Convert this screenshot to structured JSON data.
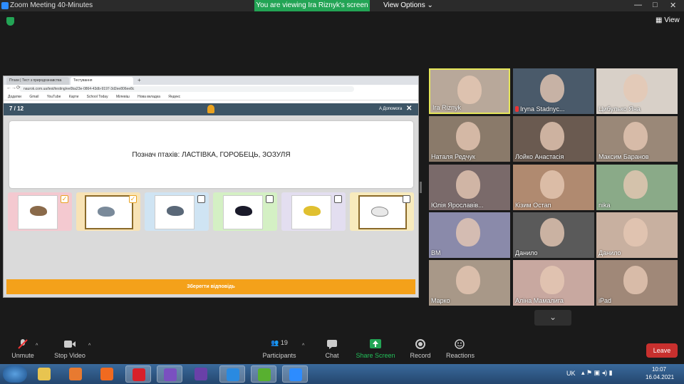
{
  "window": {
    "title": "Zoom Meeting 40-Minutes",
    "minimize": "—",
    "maximize": "□",
    "close": "✕"
  },
  "banner": {
    "text": "You are viewing Ira Riznyk's screen",
    "view_options": "View Options ⌄"
  },
  "view_button": {
    "label": "View"
  },
  "browser": {
    "tabs": [
      "Птахи | Тест з природознавства",
      "Тестування"
    ],
    "address": "naurok.com.ua/test/testing/ee0ba23e-0864-43db-9197-3d2ee806ee8c",
    "bookmarks": [
      "Додатки",
      "Gmail",
      "YouTube",
      "Карти",
      "School Today",
      "Мiлевiш",
      "Нова вкладка",
      "Яндекс"
    ]
  },
  "quiz": {
    "counter": "7 / 12",
    "help_link": "A Допомога",
    "close": "✕",
    "question": "Познач птахів: ЛАСТІВКА, ГОРОБЕЦЬ, ЗОЗУЛЯ",
    "save_button": "Зберегти відповідь",
    "options": [
      {
        "bird": "sparrow",
        "checked": true,
        "bg": "#f4c9d0"
      },
      {
        "bird": "cuckoo",
        "checked": true,
        "bg": "#f8e3b5"
      },
      {
        "bird": "pigeon",
        "checked": false,
        "bg": "#cfe4f3"
      },
      {
        "bird": "swallow",
        "checked": false,
        "bg": "#d4f0c4"
      },
      {
        "bird": "tit",
        "checked": false,
        "bg": "#e3def0"
      },
      {
        "bird": "stork",
        "checked": false,
        "bg": "#f8ebbd"
      }
    ]
  },
  "participants": [
    {
      "name": "Ira Riznyk",
      "muted": false,
      "active": true,
      "bg": "#b8a89a"
    },
    {
      "name": "Iryna Stadnyc...",
      "muted": true,
      "active": false,
      "bg": "#4a5a6a"
    },
    {
      "name": "Цибулько Яна",
      "muted": false,
      "active": false,
      "bg": "#d8d0c8"
    },
    {
      "name": "Наталя Редчук",
      "muted": false,
      "active": false,
      "bg": "#8a7a6a"
    },
    {
      "name": "Лойко Анастасія",
      "muted": false,
      "active": false,
      "bg": "#6a5a50"
    },
    {
      "name": "Максим Баранов",
      "muted": false,
      "active": false,
      "bg": "#9a8878"
    },
    {
      "name": "Юлія Ярославів...",
      "muted": false,
      "active": false,
      "bg": "#7a6a6a"
    },
    {
      "name": "Кізим Остап",
      "muted": false,
      "active": false,
      "bg": "#b08a70"
    },
    {
      "name": "nika",
      "muted": false,
      "active": false,
      "bg": "#8aaa88"
    },
    {
      "name": "ВМ",
      "muted": false,
      "active": false,
      "bg": "#8a8aaa"
    },
    {
      "name": "Данило",
      "muted": false,
      "active": false,
      "bg": "#5a5a5a"
    },
    {
      "name": "Данило",
      "muted": false,
      "active": false,
      "bg": "#c8b0a0"
    },
    {
      "name": "Марко",
      "muted": false,
      "active": false,
      "bg": "#a89888"
    },
    {
      "name": "Аліна Мамалига",
      "muted": false,
      "active": false,
      "bg": "#c8a8a0"
    },
    {
      "name": "iPad",
      "muted": false,
      "active": false,
      "bg": "#a08878"
    }
  ],
  "more_button": "⌄",
  "toolbar": {
    "unmute": "Unmute",
    "stop_video": "Stop Video",
    "participants": "Participants",
    "participants_count": "19",
    "chat": "Chat",
    "share_screen": "Share Screen",
    "record": "Record",
    "reactions": "Reactions",
    "leave": "Leave"
  },
  "taskbar": {
    "apps": [
      "explorer",
      "media",
      "firefox",
      "opera",
      "viber",
      "visual-studio",
      "ie",
      "utorrent",
      "zoom"
    ],
    "lang": "UK",
    "time": "10:07",
    "date": "16.04.2021"
  },
  "colors": {
    "accent_green": "#23a455",
    "save_orange": "#f4a11a",
    "leave_red": "#c8302e",
    "active_border": "#e6e65a"
  }
}
